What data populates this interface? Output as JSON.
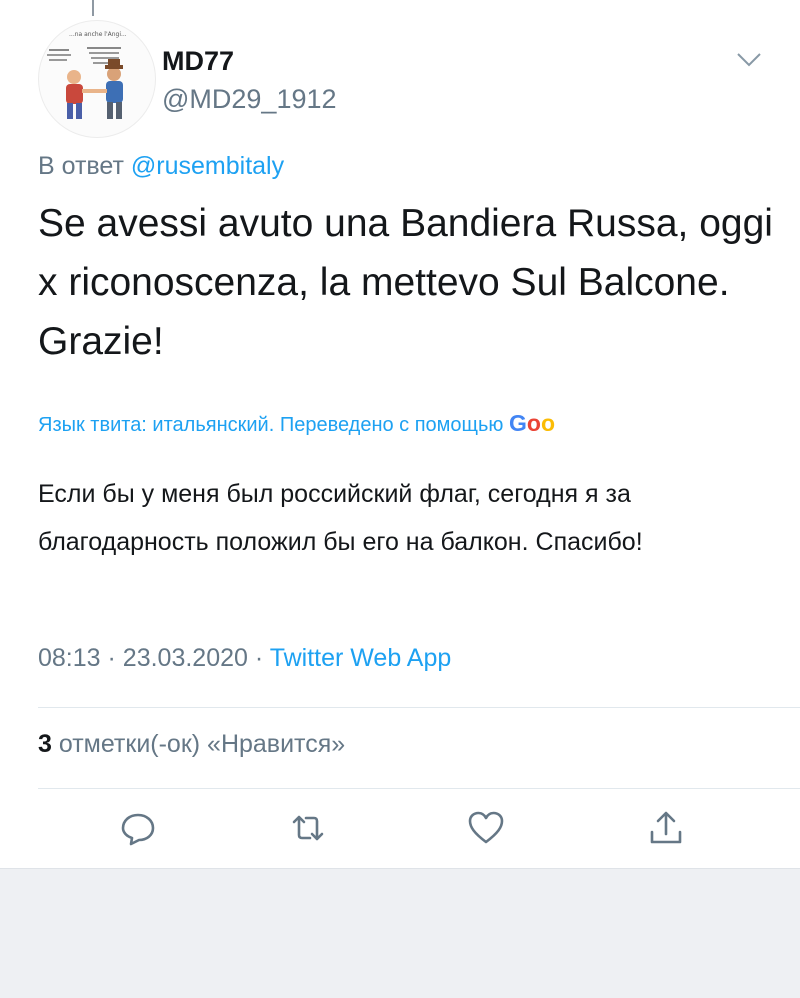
{
  "author": {
    "display_name": "MD77",
    "handle": "@MD29_1912",
    "avatar_icon": "cartoon-avatar-icon",
    "avatar_caption": "...na anche l'Angi..."
  },
  "reply": {
    "prefix": "В ответ",
    "mention": "@rusembitaly"
  },
  "tweet": {
    "text": "Se avessi avuto una Bandiera Russa, oggi x riconoscenza, la mettevo Sul Balcone. Grazie!"
  },
  "translation": {
    "notice": "Язык твита: итальянский. Переведено с помощью",
    "brand": "Goo",
    "text": "Если бы у меня был российский флаг, сегодня я за благодарность положил бы его на балкон. Спасибо!"
  },
  "meta": {
    "time": "08:13",
    "date": "23.03.2020",
    "separator": "·",
    "app": "Twitter Web App"
  },
  "likes": {
    "count": "3",
    "label": "отметки(-ок) «Нравится»"
  },
  "actions": [
    {
      "icon": "reply-icon"
    },
    {
      "icon": "retweet-icon"
    },
    {
      "icon": "like-heart-icon"
    },
    {
      "icon": "share-icon"
    }
  ],
  "colors": {
    "accent": "#1da1f2",
    "secondary_text": "#657786",
    "primary_text": "#14171a",
    "background": "#eef0f3"
  }
}
